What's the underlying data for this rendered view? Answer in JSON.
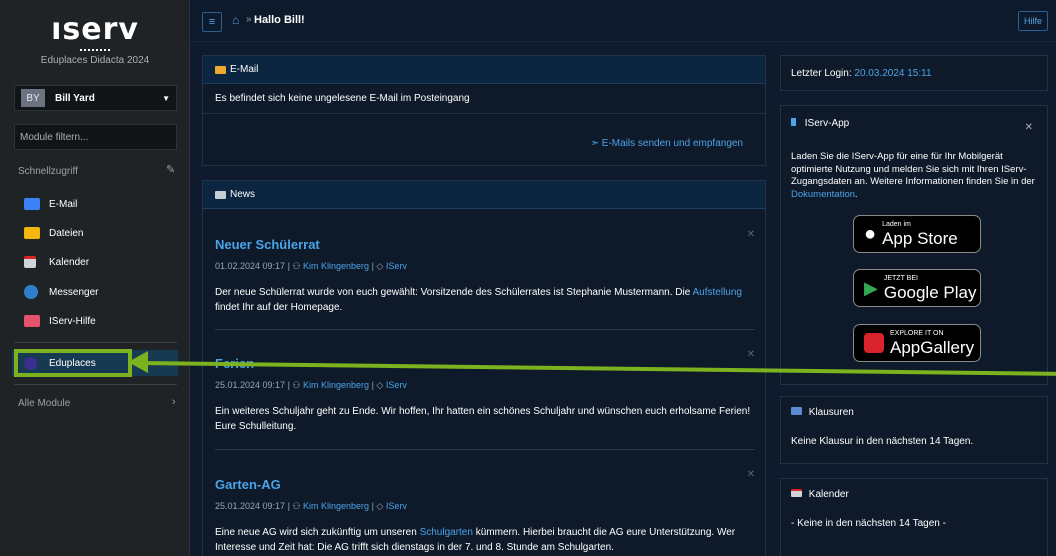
{
  "sidebar": {
    "logo": "ıserv",
    "org_name": "Eduplaces Didacta 2024",
    "user": {
      "initials": "BY",
      "name": "Bill Yard"
    },
    "filter_placeholder": "Module filtern...",
    "quick_access_title": "Schnellzugriff",
    "items": [
      {
        "label": "E-Mail",
        "icon": "mail-icon"
      },
      {
        "label": "Dateien",
        "icon": "folder-icon"
      },
      {
        "label": "Kalender",
        "icon": "calendar-icon"
      },
      {
        "label": "Messenger",
        "icon": "chat-icon"
      },
      {
        "label": "IServ-Hilfe",
        "icon": "help-icon"
      },
      {
        "label": "Eduplaces",
        "icon": "eduplaces-icon"
      }
    ],
    "all_modules": "Alle Module"
  },
  "topbar": {
    "greeting": "Hallo Bill!",
    "help": "Hilfe"
  },
  "email": {
    "title": "E-Mail",
    "message": "Es befindet sich keine ungelesene E-Mail im Posteingang",
    "action": "E-Mails senden und empfangen"
  },
  "news": {
    "title": "News",
    "items": [
      {
        "title": "Neuer Schülerrat",
        "date": "01.02.2024 09:17",
        "author": "Kim Klingenberg",
        "tag": "IServ",
        "text_before": "Der neue Schülerrat wurde von euch gewählt: Vorsitzende des Schülerrates ist Stephanie Mustermann. Die ",
        "link": "Aufstellung",
        "text_after": " findet Ihr auf der Homepage."
      },
      {
        "title": "Ferien",
        "date": "25.01.2024 09:17",
        "author": "Kim Klingenberg",
        "tag": "IServ",
        "text": "Ein weiteres Schuljahr geht zu Ende. Wir hoffen, Ihr hatten ein schönes Schuljahr und wünschen euch erholsame Ferien! Eure Schulleitung."
      },
      {
        "title": "Garten-AG",
        "date": "25.01.2024 09:17",
        "author": "Kim Klingenberg",
        "tag": "IServ",
        "text_before": "Eine neue AG wird sich zukünftig um unseren ",
        "link": "Schulgarten",
        "text_after": " kümmern. Hierbei braucht die AG eure Unterstützung. Wer Interesse und Zeit hat: Die AG trifft sich dienstags in der 7. und 8. Stunde am Schulgarten."
      }
    ]
  },
  "login": {
    "label": "Letzter Login:",
    "value": "20.03.2024 15:11"
  },
  "app": {
    "title": "IServ-App",
    "text": "Laden Sie die IServ-App für eine für Ihr Mobilgerät optimierte Nutzung und melden Sie sich mit Ihren IServ-Zugangsdaten an. Weitere Informationen finden Sie in der ",
    "link": "Dokumentation",
    "text_end": ".",
    "badges": [
      {
        "small": "Laden im",
        "big": "App Store"
      },
      {
        "small": "JETZT BEI",
        "big": "Google Play"
      },
      {
        "small": "EXPLORE IT ON",
        "big": "AppGallery"
      }
    ]
  },
  "klausuren": {
    "title": "Klausuren",
    "text": "Keine Klausur in den nächsten 14 Tagen."
  },
  "kalender": {
    "title": "Kalender",
    "text": "- Keine in den nächsten 14 Tagen -"
  },
  "colors": {
    "accent": "#4ba3e8",
    "highlight": "#7cb21f",
    "background": "#0f1b2c"
  }
}
